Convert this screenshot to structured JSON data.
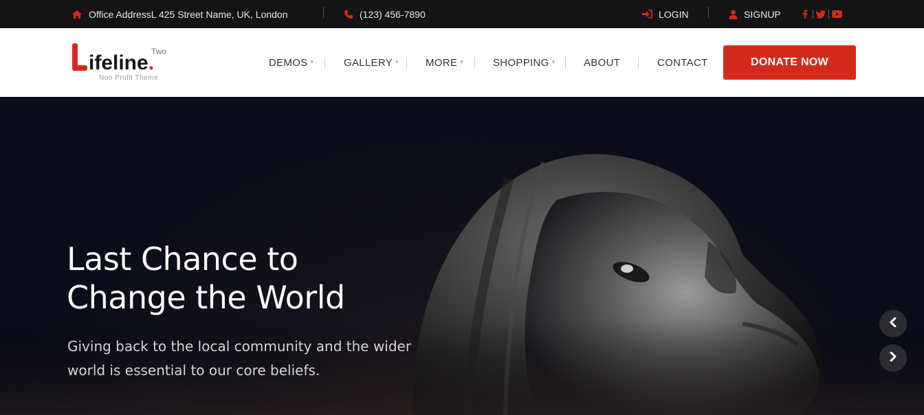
{
  "topbar": {
    "address": "Office AddressL 425 Street Name, UK, London",
    "phone": "(123) 456-7890",
    "login": "LOGIN",
    "signup": "SIGNUP",
    "icons": {
      "home": "home-icon",
      "phone": "phone-icon",
      "login": "login-icon",
      "signup": "user-icon",
      "social": [
        "facebook-icon",
        "twitter-icon",
        "youtube-icon"
      ]
    }
  },
  "logo": {
    "letter": "L",
    "name": "ifeline",
    "dot": ".",
    "superscript": "Two",
    "tagline": "Non Profit Theme"
  },
  "nav": {
    "items": [
      {
        "label": "DEMOS",
        "dropdown": true
      },
      {
        "label": "GALLERY",
        "dropdown": true
      },
      {
        "label": "MORE",
        "dropdown": true
      },
      {
        "label": "SHOPPING",
        "dropdown": true
      },
      {
        "label": "ABOUT",
        "dropdown": false
      },
      {
        "label": "CONTACT",
        "dropdown": false
      }
    ],
    "cta": "DONATE NOW"
  },
  "hero": {
    "title_line1": "Last Chance to",
    "title_line2": "Change the World",
    "subtitle_line1": "Giving back to the local community and the wider",
    "subtitle_line2": "world is essential to our core beliefs."
  },
  "colors": {
    "accent": "#d42a1c",
    "topbar": "#141414",
    "hero_bg": "#0a0c1a"
  }
}
